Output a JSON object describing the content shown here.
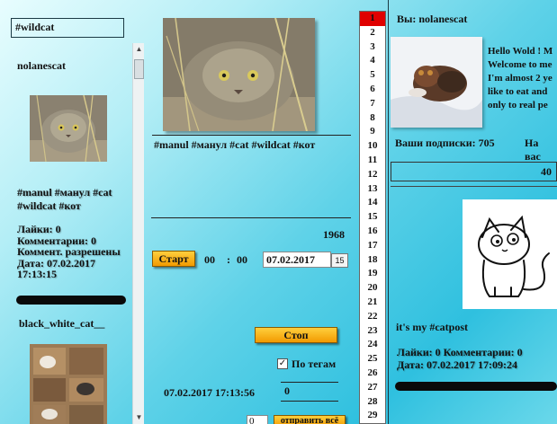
{
  "search": {
    "value": "#wildcat"
  },
  "feed": {
    "post1": {
      "username": "nolanescat",
      "tags_line1": "#manul #манул #cat",
      "tags_line2": "#wildcat #кот",
      "likes": "Лайки: 0",
      "comments": "Комментарии: 0",
      "comment_mode": "Коммент. разрешены",
      "date_line1": "Дата: 07.02.2017",
      "date_line2": "17:13:15"
    },
    "post2": {
      "username": "black_white_cat__"
    }
  },
  "middle": {
    "caption": "#manul #манул #cat #wildcat #кот",
    "number": "1968",
    "start_button": "Старт",
    "time_hours": "00",
    "time_sep": ":",
    "time_minutes": "00",
    "date_value": "07.02.2017",
    "calendar_day": "15",
    "stop_button": "Стоп",
    "by_tags_label": "По тегам",
    "checkbox_mark": "✓",
    "timestamp": "07.02.2017 17:13:56",
    "counter": "0",
    "count_value": "0",
    "send_all_button": "отправить всё"
  },
  "numbers": [
    "1",
    "2",
    "3",
    "4",
    "5",
    "6",
    "7",
    "8",
    "9",
    "10",
    "11",
    "12",
    "13",
    "14",
    "15",
    "16",
    "17",
    "18",
    "19",
    "20",
    "21",
    "22",
    "23",
    "24",
    "25",
    "26",
    "27",
    "28",
    "29"
  ],
  "profile": {
    "you_label": "Вы: nolanescat",
    "bio": "Hello Wold ! M\nWelcome to me\nI'm almost 2 ye\nlike to eat and\nonly to real pe",
    "subscriptions": "Ваши подписки: 705",
    "subscribers_partial": "На вас",
    "count": "40",
    "post_caption": "it's my #catpost",
    "likes_comments": "Лайки: 0  Комментарии: 0",
    "date": "Дата: 07.02.2017 17:09:24"
  },
  "colors": {
    "accent_orange": "#f5a300",
    "active_red": "#e00000",
    "bg_cyan": "#39c6e2"
  }
}
